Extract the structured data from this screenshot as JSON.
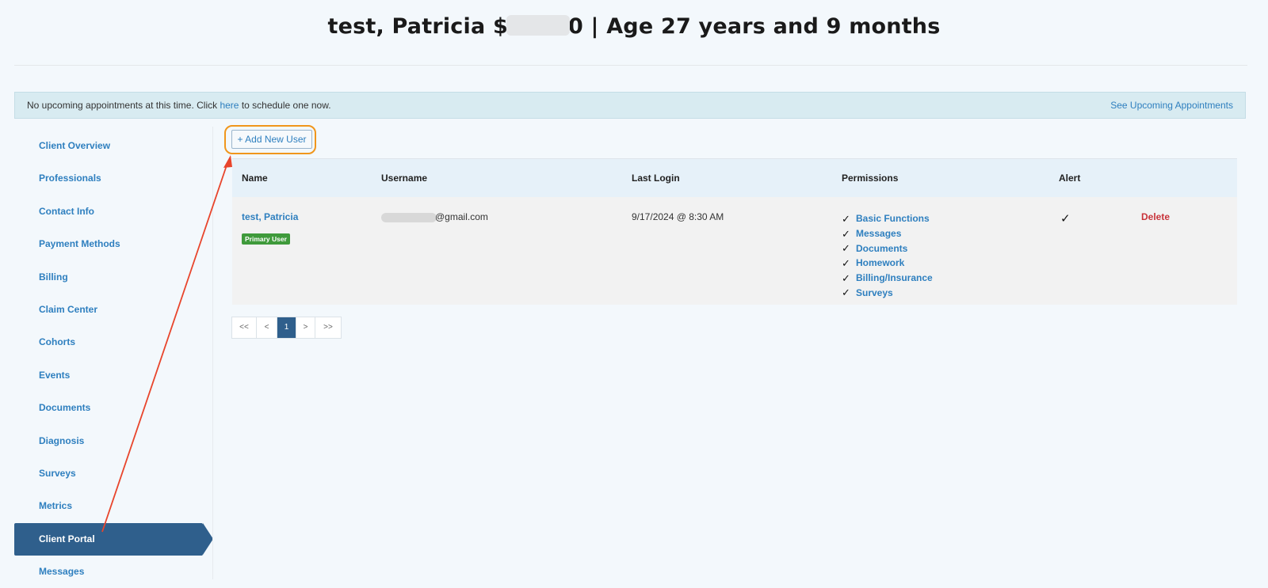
{
  "header": {
    "title_prefix": "test, Patricia $",
    "title_suffix": "0 | Age 27 years and 9 months"
  },
  "banner": {
    "text_before": "No upcoming appointments at this time. Click ",
    "link": "here",
    "text_after": " to schedule one now.",
    "right_link": "See Upcoming Appointments"
  },
  "sidebar": {
    "items": [
      {
        "label": "Client Overview",
        "active": false
      },
      {
        "label": "Professionals",
        "active": false
      },
      {
        "label": "Contact Info",
        "active": false
      },
      {
        "label": "Payment Methods",
        "active": false
      },
      {
        "label": "Billing",
        "active": false
      },
      {
        "label": "Claim Center",
        "active": false
      },
      {
        "label": "Cohorts",
        "active": false
      },
      {
        "label": "Events",
        "active": false
      },
      {
        "label": "Documents",
        "active": false
      },
      {
        "label": "Diagnosis",
        "active": false
      },
      {
        "label": "Surveys",
        "active": false
      },
      {
        "label": "Metrics",
        "active": false
      },
      {
        "label": "Client Portal",
        "active": true
      },
      {
        "label": "Messages",
        "active": false
      }
    ]
  },
  "toolbar": {
    "add_user_label": "+ Add New User"
  },
  "table": {
    "headers": {
      "name": "Name",
      "username": "Username",
      "last_login": "Last Login",
      "permissions": "Permissions",
      "alert": "Alert"
    },
    "rows": [
      {
        "name": "test, Patricia",
        "badge": "Primary User",
        "username_suffix": "@gmail.com",
        "last_login": "9/17/2024 @ 8:30 AM",
        "permissions": [
          "Basic Functions",
          "Messages",
          "Documents",
          "Homework",
          "Billing/Insurance",
          "Surveys"
        ],
        "alert": "✓",
        "delete_label": "Delete"
      }
    ]
  },
  "pagination": {
    "first": "<<",
    "prev": "<",
    "current": "1",
    "next": ">",
    "last": ">>"
  },
  "colors": {
    "accent": "#2e7fbf",
    "active_nav": "#2f5f8c",
    "highlight_ring": "#f0961c",
    "annotation_arrow": "#e8452c",
    "delete": "#c8333a",
    "badge": "#3f9a3b"
  }
}
